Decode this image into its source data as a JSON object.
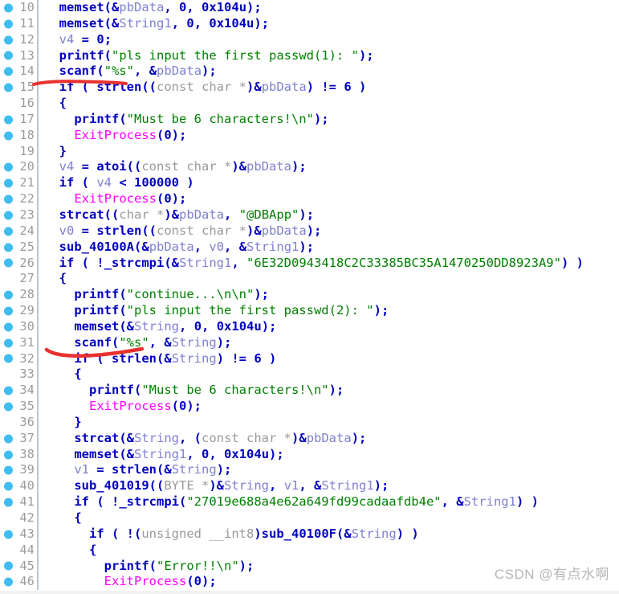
{
  "view": {
    "title": "IDA Pseudocode View",
    "watermark": "CSDN @有点水啊",
    "colors": {
      "keyword": "#0000c0",
      "variable": "#8080d0",
      "api": "#ff00ff",
      "string": "#008000",
      "type": "#9a9a9a",
      "line_number": "#9a9a9a",
      "breakpoint_dot": "#3fbdf1",
      "separator": "#b9c6d6",
      "annotation": "#e8312f",
      "background": "#ffffff"
    }
  },
  "lines": [
    {
      "num": "10",
      "bp": true,
      "indent": 1,
      "tokens": [
        {
          "t": "memset",
          "c": "fn"
        },
        {
          "t": "(",
          "c": "pl"
        },
        {
          "t": "&",
          "c": "pl"
        },
        {
          "t": "pbData",
          "c": "var"
        },
        {
          "t": ", ",
          "c": "pl"
        },
        {
          "t": "0",
          "c": "num"
        },
        {
          "t": ", ",
          "c": "pl"
        },
        {
          "t": "0x104u",
          "c": "num"
        },
        {
          "t": ");",
          "c": "pl"
        }
      ]
    },
    {
      "num": "11",
      "bp": true,
      "indent": 1,
      "tokens": [
        {
          "t": "memset",
          "c": "fn"
        },
        {
          "t": "(",
          "c": "pl"
        },
        {
          "t": "&",
          "c": "pl"
        },
        {
          "t": "String1",
          "c": "var"
        },
        {
          "t": ", ",
          "c": "pl"
        },
        {
          "t": "0",
          "c": "num"
        },
        {
          "t": ", ",
          "c": "pl"
        },
        {
          "t": "0x104u",
          "c": "num"
        },
        {
          "t": ");",
          "c": "pl"
        }
      ]
    },
    {
      "num": "12",
      "bp": true,
      "indent": 1,
      "tokens": [
        {
          "t": "v4",
          "c": "var"
        },
        {
          "t": " = ",
          "c": "pl"
        },
        {
          "t": "0",
          "c": "num"
        },
        {
          "t": ";",
          "c": "pl"
        }
      ]
    },
    {
      "num": "13",
      "bp": true,
      "indent": 1,
      "tokens": [
        {
          "t": "printf",
          "c": "fn"
        },
        {
          "t": "(",
          "c": "pl"
        },
        {
          "t": "\"pls input the first passwd(1): \"",
          "c": "str"
        },
        {
          "t": ");",
          "c": "pl"
        }
      ]
    },
    {
      "num": "14",
      "bp": true,
      "indent": 1,
      "tokens": [
        {
          "t": "scanf",
          "c": "fn"
        },
        {
          "t": "(",
          "c": "pl"
        },
        {
          "t": "\"%s\"",
          "c": "str"
        },
        {
          "t": ", ",
          "c": "pl"
        },
        {
          "t": "&",
          "c": "pl"
        },
        {
          "t": "pbData",
          "c": "var"
        },
        {
          "t": ");",
          "c": "pl"
        }
      ]
    },
    {
      "num": "15",
      "bp": true,
      "indent": 1,
      "tokens": [
        {
          "t": "if",
          "c": "kw"
        },
        {
          "t": " ( ",
          "c": "pl"
        },
        {
          "t": "strlen",
          "c": "fn"
        },
        {
          "t": "((",
          "c": "pl"
        },
        {
          "t": "const char *",
          "c": "type"
        },
        {
          "t": ")",
          "c": "pl"
        },
        {
          "t": "&",
          "c": "pl"
        },
        {
          "t": "pbData",
          "c": "var"
        },
        {
          "t": ") != ",
          "c": "pl"
        },
        {
          "t": "6",
          "c": "num"
        },
        {
          "t": " )",
          "c": "pl"
        }
      ]
    },
    {
      "num": "16",
      "bp": false,
      "indent": 1,
      "tokens": [
        {
          "t": "{",
          "c": "pl"
        }
      ]
    },
    {
      "num": "17",
      "bp": true,
      "indent": 2,
      "tokens": [
        {
          "t": "printf",
          "c": "fn"
        },
        {
          "t": "(",
          "c": "pl"
        },
        {
          "t": "\"Must be 6 characters!\\n\"",
          "c": "str"
        },
        {
          "t": ");",
          "c": "pl"
        }
      ]
    },
    {
      "num": "18",
      "bp": true,
      "indent": 2,
      "tokens": [
        {
          "t": "ExitProcess",
          "c": "api"
        },
        {
          "t": "(",
          "c": "pl"
        },
        {
          "t": "0",
          "c": "num"
        },
        {
          "t": ");",
          "c": "pl"
        }
      ]
    },
    {
      "num": "19",
      "bp": false,
      "indent": 1,
      "tokens": [
        {
          "t": "}",
          "c": "pl"
        }
      ]
    },
    {
      "num": "20",
      "bp": true,
      "indent": 1,
      "tokens": [
        {
          "t": "v4",
          "c": "var"
        },
        {
          "t": " = ",
          "c": "pl"
        },
        {
          "t": "atoi",
          "c": "fn"
        },
        {
          "t": "((",
          "c": "pl"
        },
        {
          "t": "const char *",
          "c": "type"
        },
        {
          "t": ")",
          "c": "pl"
        },
        {
          "t": "&",
          "c": "pl"
        },
        {
          "t": "pbData",
          "c": "var"
        },
        {
          "t": ");",
          "c": "pl"
        }
      ]
    },
    {
      "num": "21",
      "bp": true,
      "indent": 1,
      "tokens": [
        {
          "t": "if",
          "c": "kw"
        },
        {
          "t": " ( ",
          "c": "pl"
        },
        {
          "t": "v4",
          "c": "var"
        },
        {
          "t": " < ",
          "c": "pl"
        },
        {
          "t": "100000",
          "c": "num"
        },
        {
          "t": " )",
          "c": "pl"
        }
      ]
    },
    {
      "num": "22",
      "bp": true,
      "indent": 2,
      "tokens": [
        {
          "t": "ExitProcess",
          "c": "api"
        },
        {
          "t": "(",
          "c": "pl"
        },
        {
          "t": "0",
          "c": "num"
        },
        {
          "t": ");",
          "c": "pl"
        }
      ]
    },
    {
      "num": "23",
      "bp": true,
      "indent": 1,
      "tokens": [
        {
          "t": "strcat",
          "c": "fn"
        },
        {
          "t": "((",
          "c": "pl"
        },
        {
          "t": "char *",
          "c": "type"
        },
        {
          "t": ")",
          "c": "pl"
        },
        {
          "t": "&",
          "c": "pl"
        },
        {
          "t": "pbData",
          "c": "var"
        },
        {
          "t": ", ",
          "c": "pl"
        },
        {
          "t": "\"@DBApp\"",
          "c": "str"
        },
        {
          "t": ");",
          "c": "pl"
        }
      ]
    },
    {
      "num": "24",
      "bp": true,
      "indent": 1,
      "tokens": [
        {
          "t": "v0",
          "c": "var"
        },
        {
          "t": " = ",
          "c": "pl"
        },
        {
          "t": "strlen",
          "c": "fn"
        },
        {
          "t": "((",
          "c": "pl"
        },
        {
          "t": "const char *",
          "c": "type"
        },
        {
          "t": ")",
          "c": "pl"
        },
        {
          "t": "&",
          "c": "pl"
        },
        {
          "t": "pbData",
          "c": "var"
        },
        {
          "t": ");",
          "c": "pl"
        }
      ]
    },
    {
      "num": "25",
      "bp": true,
      "indent": 1,
      "tokens": [
        {
          "t": "sub_40100A",
          "c": "fn"
        },
        {
          "t": "(",
          "c": "pl"
        },
        {
          "t": "&",
          "c": "pl"
        },
        {
          "t": "pbData",
          "c": "var"
        },
        {
          "t": ", ",
          "c": "pl"
        },
        {
          "t": "v0",
          "c": "var"
        },
        {
          "t": ", ",
          "c": "pl"
        },
        {
          "t": "&",
          "c": "pl"
        },
        {
          "t": "String1",
          "c": "var"
        },
        {
          "t": ");",
          "c": "pl"
        }
      ]
    },
    {
      "num": "26",
      "bp": true,
      "indent": 1,
      "tokens": [
        {
          "t": "if",
          "c": "kw"
        },
        {
          "t": " ( !",
          "c": "pl"
        },
        {
          "t": "_strcmpi",
          "c": "fn"
        },
        {
          "t": "(",
          "c": "pl"
        },
        {
          "t": "&",
          "c": "pl"
        },
        {
          "t": "String1",
          "c": "var"
        },
        {
          "t": ", ",
          "c": "pl"
        },
        {
          "t": "\"6E32D0943418C2C33385BC35A1470250DD8923A9\"",
          "c": "str"
        },
        {
          "t": ") )",
          "c": "pl"
        }
      ]
    },
    {
      "num": "27",
      "bp": false,
      "indent": 1,
      "tokens": [
        {
          "t": "{",
          "c": "pl"
        }
      ]
    },
    {
      "num": "28",
      "bp": true,
      "indent": 2,
      "tokens": [
        {
          "t": "printf",
          "c": "fn"
        },
        {
          "t": "(",
          "c": "pl"
        },
        {
          "t": "\"continue...\\n\\n\"",
          "c": "str"
        },
        {
          "t": ");",
          "c": "pl"
        }
      ]
    },
    {
      "num": "29",
      "bp": true,
      "indent": 2,
      "tokens": [
        {
          "t": "printf",
          "c": "fn"
        },
        {
          "t": "(",
          "c": "pl"
        },
        {
          "t": "\"pls input the first passwd(2): \"",
          "c": "str"
        },
        {
          "t": ");",
          "c": "pl"
        }
      ]
    },
    {
      "num": "30",
      "bp": true,
      "indent": 2,
      "tokens": [
        {
          "t": "memset",
          "c": "fn"
        },
        {
          "t": "(",
          "c": "pl"
        },
        {
          "t": "&",
          "c": "pl"
        },
        {
          "t": "String",
          "c": "var"
        },
        {
          "t": ", ",
          "c": "pl"
        },
        {
          "t": "0",
          "c": "num"
        },
        {
          "t": ", ",
          "c": "pl"
        },
        {
          "t": "0x104u",
          "c": "num"
        },
        {
          "t": ");",
          "c": "pl"
        }
      ]
    },
    {
      "num": "31",
      "bp": true,
      "indent": 2,
      "tokens": [
        {
          "t": "scanf",
          "c": "fn"
        },
        {
          "t": "(",
          "c": "pl"
        },
        {
          "t": "\"%s\"",
          "c": "str"
        },
        {
          "t": ", ",
          "c": "pl"
        },
        {
          "t": "&",
          "c": "pl"
        },
        {
          "t": "String",
          "c": "var"
        },
        {
          "t": ");",
          "c": "pl"
        }
      ]
    },
    {
      "num": "32",
      "bp": true,
      "indent": 2,
      "tokens": [
        {
          "t": "if",
          "c": "kw"
        },
        {
          "t": " ( ",
          "c": "pl"
        },
        {
          "t": "strlen",
          "c": "fn"
        },
        {
          "t": "(",
          "c": "pl"
        },
        {
          "t": "&",
          "c": "pl"
        },
        {
          "t": "String",
          "c": "var"
        },
        {
          "t": ") != ",
          "c": "pl"
        },
        {
          "t": "6",
          "c": "num"
        },
        {
          "t": " )",
          "c": "pl"
        }
      ]
    },
    {
      "num": "33",
      "bp": false,
      "indent": 2,
      "tokens": [
        {
          "t": "{",
          "c": "pl"
        }
      ]
    },
    {
      "num": "34",
      "bp": true,
      "indent": 3,
      "tokens": [
        {
          "t": "printf",
          "c": "fn"
        },
        {
          "t": "(",
          "c": "pl"
        },
        {
          "t": "\"Must be 6 characters!\\n\"",
          "c": "str"
        },
        {
          "t": ");",
          "c": "pl"
        }
      ]
    },
    {
      "num": "35",
      "bp": true,
      "indent": 3,
      "tokens": [
        {
          "t": "ExitProcess",
          "c": "api"
        },
        {
          "t": "(",
          "c": "pl"
        },
        {
          "t": "0",
          "c": "num"
        },
        {
          "t": ");",
          "c": "pl"
        }
      ]
    },
    {
      "num": "36",
      "bp": false,
      "indent": 2,
      "tokens": [
        {
          "t": "}",
          "c": "pl"
        }
      ]
    },
    {
      "num": "37",
      "bp": true,
      "indent": 2,
      "tokens": [
        {
          "t": "strcat",
          "c": "fn"
        },
        {
          "t": "(",
          "c": "pl"
        },
        {
          "t": "&",
          "c": "pl"
        },
        {
          "t": "String",
          "c": "var"
        },
        {
          "t": ", (",
          "c": "pl"
        },
        {
          "t": "const char *",
          "c": "type"
        },
        {
          "t": ")",
          "c": "pl"
        },
        {
          "t": "&",
          "c": "pl"
        },
        {
          "t": "pbData",
          "c": "var"
        },
        {
          "t": ");",
          "c": "pl"
        }
      ]
    },
    {
      "num": "38",
      "bp": true,
      "indent": 2,
      "tokens": [
        {
          "t": "memset",
          "c": "fn"
        },
        {
          "t": "(",
          "c": "pl"
        },
        {
          "t": "&",
          "c": "pl"
        },
        {
          "t": "String1",
          "c": "var"
        },
        {
          "t": ", ",
          "c": "pl"
        },
        {
          "t": "0",
          "c": "num"
        },
        {
          "t": ", ",
          "c": "pl"
        },
        {
          "t": "0x104u",
          "c": "num"
        },
        {
          "t": ");",
          "c": "pl"
        }
      ]
    },
    {
      "num": "39",
      "bp": true,
      "indent": 2,
      "tokens": [
        {
          "t": "v1",
          "c": "var"
        },
        {
          "t": " = ",
          "c": "pl"
        },
        {
          "t": "strlen",
          "c": "fn"
        },
        {
          "t": "(",
          "c": "pl"
        },
        {
          "t": "&",
          "c": "pl"
        },
        {
          "t": "String",
          "c": "var"
        },
        {
          "t": ");",
          "c": "pl"
        }
      ]
    },
    {
      "num": "40",
      "bp": true,
      "indent": 2,
      "tokens": [
        {
          "t": "sub_401019",
          "c": "fn"
        },
        {
          "t": "((",
          "c": "pl"
        },
        {
          "t": "BYTE *",
          "c": "type"
        },
        {
          "t": ")",
          "c": "pl"
        },
        {
          "t": "&",
          "c": "pl"
        },
        {
          "t": "String",
          "c": "var"
        },
        {
          "t": ", ",
          "c": "pl"
        },
        {
          "t": "v1",
          "c": "var"
        },
        {
          "t": ", ",
          "c": "pl"
        },
        {
          "t": "&",
          "c": "pl"
        },
        {
          "t": "String1",
          "c": "var"
        },
        {
          "t": ");",
          "c": "pl"
        }
      ]
    },
    {
      "num": "41",
      "bp": true,
      "indent": 2,
      "tokens": [
        {
          "t": "if",
          "c": "kw"
        },
        {
          "t": " ( !",
          "c": "pl"
        },
        {
          "t": "_strcmpi",
          "c": "fn"
        },
        {
          "t": "(",
          "c": "pl"
        },
        {
          "t": "\"27019e688a4e62a649fd99cadaafdb4e\"",
          "c": "str"
        },
        {
          "t": ", ",
          "c": "pl"
        },
        {
          "t": "&",
          "c": "pl"
        },
        {
          "t": "String1",
          "c": "var"
        },
        {
          "t": ") )",
          "c": "pl"
        }
      ]
    },
    {
      "num": "42",
      "bp": false,
      "indent": 2,
      "tokens": [
        {
          "t": "{",
          "c": "pl"
        }
      ]
    },
    {
      "num": "43",
      "bp": true,
      "indent": 3,
      "tokens": [
        {
          "t": "if",
          "c": "kw"
        },
        {
          "t": " ( !(",
          "c": "pl"
        },
        {
          "t": "unsigned __int8",
          "c": "type"
        },
        {
          "t": ")",
          "c": "pl"
        },
        {
          "t": "sub_40100F",
          "c": "fn"
        },
        {
          "t": "(",
          "c": "pl"
        },
        {
          "t": "&",
          "c": "pl"
        },
        {
          "t": "String",
          "c": "var"
        },
        {
          "t": ") )",
          "c": "pl"
        }
      ]
    },
    {
      "num": "44",
      "bp": false,
      "indent": 3,
      "tokens": [
        {
          "t": "{",
          "c": "pl"
        }
      ]
    },
    {
      "num": "45",
      "bp": true,
      "indent": 4,
      "tokens": [
        {
          "t": "printf",
          "c": "fn"
        },
        {
          "t": "(",
          "c": "pl"
        },
        {
          "t": "\"Error!!\\n\"",
          "c": "str"
        },
        {
          "t": ");",
          "c": "pl"
        }
      ]
    },
    {
      "num": "46",
      "bp": true,
      "indent": 4,
      "tokens": [
        {
          "t": "ExitProcess",
          "c": "api"
        },
        {
          "t": "(",
          "c": "pl"
        },
        {
          "t": "0",
          "c": "num"
        },
        {
          "t": ");",
          "c": "pl"
        }
      ]
    }
  ]
}
